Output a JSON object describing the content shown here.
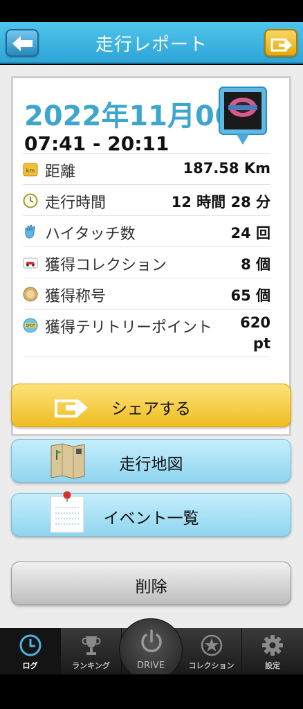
{
  "header": {
    "title": "走行レポート"
  },
  "report": {
    "date": "2022年11月06",
    "time_range": "07:41 - 20:11",
    "stats": [
      {
        "icon": "km-icon",
        "label": "距離",
        "value": "187.58 Km"
      },
      {
        "icon": "clock-icon",
        "label": "走行時間",
        "value": "12 時間 28 分"
      },
      {
        "icon": "hand-icon",
        "label": "ハイタッチ数",
        "value": "24 回"
      },
      {
        "icon": "car-icon",
        "label": "獲得コレクション",
        "value": "8 個"
      },
      {
        "icon": "medal-icon",
        "label": "獲得称号",
        "value": "65 個"
      },
      {
        "icon": "spot-icon",
        "label": "獲得テリトリーポイント",
        "value": "620 pt"
      }
    ]
  },
  "actions": {
    "share": "シェアする",
    "map": "走行地図",
    "events": "イベント一覧",
    "delete": "削除"
  },
  "tabs": {
    "log": "ログ",
    "ranking": "ランキング",
    "drive": "DRIVE",
    "collection": "コレクション",
    "settings": "設定"
  }
}
